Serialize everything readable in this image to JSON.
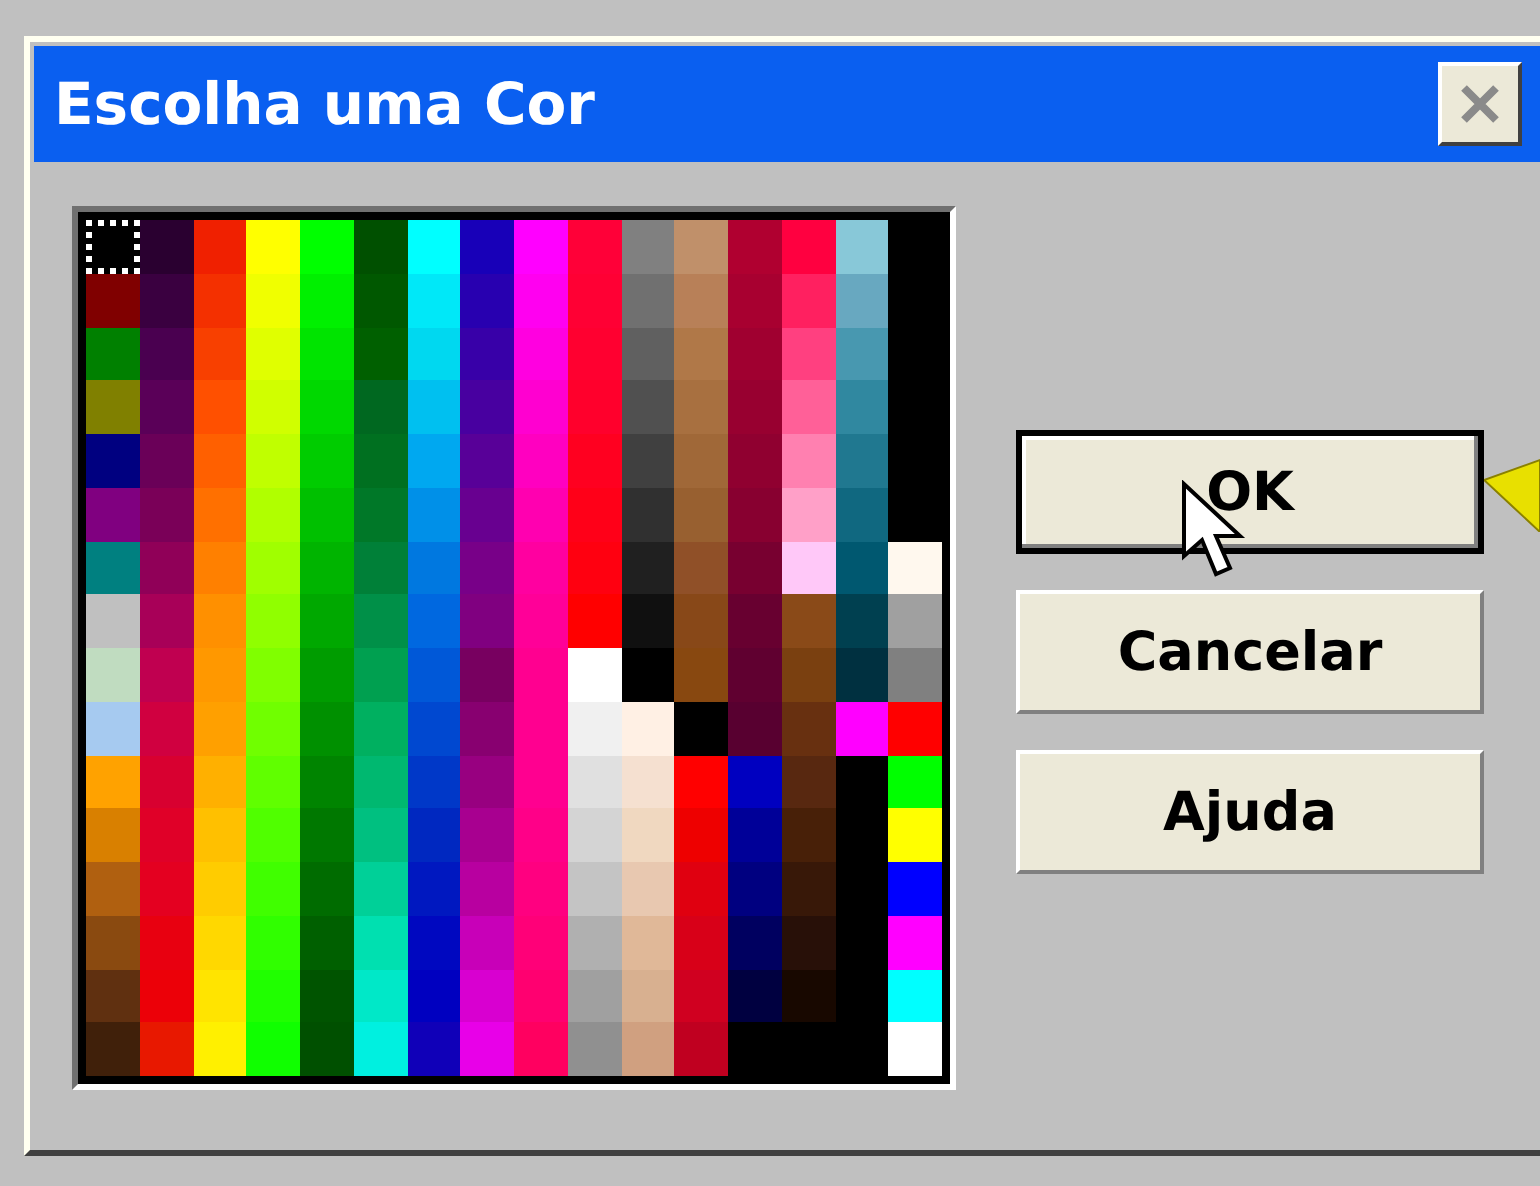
{
  "window": {
    "title": "Escolha uma Cor"
  },
  "palette": {
    "rows": [
      [
        {
          "color": "#000000",
          "selected": true
        },
        {
          "color": "#2a0030",
          "selected": false
        },
        {
          "color": "#f02000",
          "selected": false
        },
        {
          "color": "#ffff00",
          "selected": false
        },
        {
          "color": "#00ff00",
          "selected": false
        },
        {
          "color": "#005000",
          "selected": false
        },
        {
          "color": "#00ffff",
          "selected": false
        },
        {
          "color": "#1800b8",
          "selected": false
        },
        {
          "color": "#ff00ff",
          "selected": false
        },
        {
          "color": "#ff0038",
          "selected": false
        },
        {
          "color": "#808080",
          "selected": false
        },
        {
          "color": "#c0906a",
          "selected": false
        },
        {
          "color": "#b00030",
          "selected": false
        },
        {
          "color": "#ff0040",
          "selected": false
        },
        {
          "color": "#88c8d8",
          "selected": false
        },
        {
          "color": "#000000",
          "selected": false
        }
      ],
      [
        {
          "color": "#800000",
          "selected": false
        },
        {
          "color": "#3a0040",
          "selected": false
        },
        {
          "color": "#f43000",
          "selected": false
        },
        {
          "color": "#f0ff00",
          "selected": false
        },
        {
          "color": "#00f000",
          "selected": false
        },
        {
          "color": "#005800",
          "selected": false
        },
        {
          "color": "#00e8f8",
          "selected": false
        },
        {
          "color": "#2800b0",
          "selected": false
        },
        {
          "color": "#ff00f0",
          "selected": false
        },
        {
          "color": "#ff0034",
          "selected": false
        },
        {
          "color": "#707070",
          "selected": false
        },
        {
          "color": "#b88058",
          "selected": false
        },
        {
          "color": "#a80030",
          "selected": false
        },
        {
          "color": "#ff2060",
          "selected": false
        },
        {
          "color": "#68a8c0",
          "selected": false
        },
        {
          "color": "#000000",
          "selected": false
        }
      ],
      [
        {
          "color": "#008000",
          "selected": false
        },
        {
          "color": "#4a0050",
          "selected": false
        },
        {
          "color": "#f84000",
          "selected": false
        },
        {
          "color": "#e0ff00",
          "selected": false
        },
        {
          "color": "#00e400",
          "selected": false
        },
        {
          "color": "#006000",
          "selected": false
        },
        {
          "color": "#00d8f0",
          "selected": false
        },
        {
          "color": "#3800a8",
          "selected": false
        },
        {
          "color": "#ff00e0",
          "selected": false
        },
        {
          "color": "#ff0030",
          "selected": false
        },
        {
          "color": "#606060",
          "selected": false
        },
        {
          "color": "#b07848",
          "selected": false
        },
        {
          "color": "#a00030",
          "selected": false
        },
        {
          "color": "#ff4080",
          "selected": false
        },
        {
          "color": "#4898b0",
          "selected": false
        },
        {
          "color": "#000000",
          "selected": false
        }
      ],
      [
        {
          "color": "#808000",
          "selected": false
        },
        {
          "color": "#5a0058",
          "selected": false
        },
        {
          "color": "#ff5000",
          "selected": false
        },
        {
          "color": "#d0ff00",
          "selected": false
        },
        {
          "color": "#00d800",
          "selected": false
        },
        {
          "color": "#006820",
          "selected": false
        },
        {
          "color": "#00c0f0",
          "selected": false
        },
        {
          "color": "#4800a0",
          "selected": false
        },
        {
          "color": "#ff00d0",
          "selected": false
        },
        {
          "color": "#ff002c",
          "selected": false
        },
        {
          "color": "#505050",
          "selected": false
        },
        {
          "color": "#a87040",
          "selected": false
        },
        {
          "color": "#980030",
          "selected": false
        },
        {
          "color": "#ff6098",
          "selected": false
        },
        {
          "color": "#3088a0",
          "selected": false
        },
        {
          "color": "#000000",
          "selected": false
        }
      ],
      [
        {
          "color": "#000080",
          "selected": false
        },
        {
          "color": "#6a0058",
          "selected": false
        },
        {
          "color": "#ff6000",
          "selected": false
        },
        {
          "color": "#c0ff00",
          "selected": false
        },
        {
          "color": "#00cc00",
          "selected": false
        },
        {
          "color": "#007020",
          "selected": false
        },
        {
          "color": "#00a8f0",
          "selected": false
        },
        {
          "color": "#580098",
          "selected": false
        },
        {
          "color": "#ff00c0",
          "selected": false
        },
        {
          "color": "#ff0020",
          "selected": false
        },
        {
          "color": "#404040",
          "selected": false
        },
        {
          "color": "#a06838",
          "selected": false
        },
        {
          "color": "#900030",
          "selected": false
        },
        {
          "color": "#ff80b0",
          "selected": false
        },
        {
          "color": "#207890",
          "selected": false
        },
        {
          "color": "#000000",
          "selected": false
        }
      ],
      [
        {
          "color": "#800080",
          "selected": false
        },
        {
          "color": "#7a0058",
          "selected": false
        },
        {
          "color": "#ff7000",
          "selected": false
        },
        {
          "color": "#b0ff00",
          "selected": false
        },
        {
          "color": "#00c000",
          "selected": false
        },
        {
          "color": "#007828",
          "selected": false
        },
        {
          "color": "#0090e8",
          "selected": false
        },
        {
          "color": "#680090",
          "selected": false
        },
        {
          "color": "#ff00b0",
          "selected": false
        },
        {
          "color": "#ff0018",
          "selected": false
        },
        {
          "color": "#303030",
          "selected": false
        },
        {
          "color": "#986030",
          "selected": false
        },
        {
          "color": "#880030",
          "selected": false
        },
        {
          "color": "#ffa0c8",
          "selected": false
        },
        {
          "color": "#106880",
          "selected": false
        },
        {
          "color": "#000000",
          "selected": false
        }
      ],
      [
        {
          "color": "#008080",
          "selected": false
        },
        {
          "color": "#900058",
          "selected": false
        },
        {
          "color": "#ff8000",
          "selected": false
        },
        {
          "color": "#a0ff00",
          "selected": false
        },
        {
          "color": "#00b400",
          "selected": false
        },
        {
          "color": "#008038",
          "selected": false
        },
        {
          "color": "#0078e0",
          "selected": false
        },
        {
          "color": "#780088",
          "selected": false
        },
        {
          "color": "#ff00a0",
          "selected": false
        },
        {
          "color": "#ff0010",
          "selected": false
        },
        {
          "color": "#202020",
          "selected": false
        },
        {
          "color": "#905028",
          "selected": false
        },
        {
          "color": "#780030",
          "selected": false
        },
        {
          "color": "#ffc8f8",
          "selected": false
        },
        {
          "color": "#005870",
          "selected": false
        },
        {
          "color": "#fff8ee",
          "selected": false
        }
      ],
      [
        {
          "color": "#c0c0c0",
          "selected": false
        },
        {
          "color": "#a80058",
          "selected": false
        },
        {
          "color": "#ff9000",
          "selected": false
        },
        {
          "color": "#90ff00",
          "selected": false
        },
        {
          "color": "#00a800",
          "selected": false
        },
        {
          "color": "#009048",
          "selected": false
        },
        {
          "color": "#0068e0",
          "selected": false
        },
        {
          "color": "#800080",
          "selected": false
        },
        {
          "color": "#ff0098",
          "selected": false
        },
        {
          "color": "#ff0000",
          "selected": false
        },
        {
          "color": "#101010",
          "selected": false
        },
        {
          "color": "#884818",
          "selected": false
        },
        {
          "color": "#680030",
          "selected": false
        },
        {
          "color": "#8a4a18",
          "selected": false
        },
        {
          "color": "#004050",
          "selected": false
        },
        {
          "color": "#a0a0a0",
          "selected": false
        }
      ],
      [
        {
          "color": "#c0dcc0",
          "selected": false
        },
        {
          "color": "#c00050",
          "selected": false
        },
        {
          "color": "#ff9800",
          "selected": false
        },
        {
          "color": "#80ff00",
          "selected": false
        },
        {
          "color": "#009c00",
          "selected": false
        },
        {
          "color": "#00a050",
          "selected": false
        },
        {
          "color": "#0058d8",
          "selected": false
        },
        {
          "color": "#780060",
          "selected": false
        },
        {
          "color": "#ff0090",
          "selected": false
        },
        {
          "color": "#ffffff",
          "selected": false
        },
        {
          "color": "#000000",
          "selected": false
        },
        {
          "color": "#884810",
          "selected": false
        },
        {
          "color": "#600030",
          "selected": false
        },
        {
          "color": "#7a4010",
          "selected": false
        },
        {
          "color": "#003040",
          "selected": false
        },
        {
          "color": "#808080",
          "selected": false
        }
      ],
      [
        {
          "color": "#a6caf0",
          "selected": false
        },
        {
          "color": "#d00040",
          "selected": false
        },
        {
          "color": "#ffa000",
          "selected": false
        },
        {
          "color": "#70ff00",
          "selected": false
        },
        {
          "color": "#009000",
          "selected": false
        },
        {
          "color": "#00b060",
          "selected": false
        },
        {
          "color": "#0048d0",
          "selected": false
        },
        {
          "color": "#880070",
          "selected": false
        },
        {
          "color": "#ff0090",
          "selected": false
        },
        {
          "color": "#f0f0f0",
          "selected": false
        },
        {
          "color": "#fff0e4",
          "selected": false
        },
        {
          "color": "#000000",
          "selected": false
        },
        {
          "color": "#580030",
          "selected": false
        },
        {
          "color": "#683010",
          "selected": false
        },
        {
          "color": "#ff00ff",
          "selected": false
        },
        {
          "color": "#ff0000",
          "selected": false
        }
      ],
      [
        {
          "color": "#ffa200",
          "selected": false
        },
        {
          "color": "#d80030",
          "selected": false
        },
        {
          "color": "#ffb000",
          "selected": false
        },
        {
          "color": "#60ff00",
          "selected": false
        },
        {
          "color": "#008400",
          "selected": false
        },
        {
          "color": "#00b870",
          "selected": false
        },
        {
          "color": "#0038c8",
          "selected": false
        },
        {
          "color": "#980080",
          "selected": false
        },
        {
          "color": "#ff0090",
          "selected": false
        },
        {
          "color": "#e0e0e0",
          "selected": false
        },
        {
          "color": "#f5e0d0",
          "selected": false
        },
        {
          "color": "#ff0000",
          "selected": false
        },
        {
          "color": "#0000c0",
          "selected": false
        },
        {
          "color": "#582810",
          "selected": false
        },
        {
          "color": "#000000",
          "selected": false
        },
        {
          "color": "#00ff00",
          "selected": false
        }
      ],
      [
        {
          "color": "#d98000",
          "selected": false
        },
        {
          "color": "#e00028",
          "selected": false
        },
        {
          "color": "#ffc000",
          "selected": false
        },
        {
          "color": "#50ff00",
          "selected": false
        },
        {
          "color": "#007800",
          "selected": false
        },
        {
          "color": "#00c080",
          "selected": false
        },
        {
          "color": "#0028c0",
          "selected": false
        },
        {
          "color": "#a80090",
          "selected": false
        },
        {
          "color": "#ff0088",
          "selected": false
        },
        {
          "color": "#d4d4d4",
          "selected": false
        },
        {
          "color": "#f0d8c0",
          "selected": false
        },
        {
          "color": "#ee0000",
          "selected": false
        },
        {
          "color": "#000098",
          "selected": false
        },
        {
          "color": "#482008",
          "selected": false
        },
        {
          "color": "#000000",
          "selected": false
        },
        {
          "color": "#ffff00",
          "selected": false
        }
      ],
      [
        {
          "color": "#b06010",
          "selected": false
        },
        {
          "color": "#e40020",
          "selected": false
        },
        {
          "color": "#ffcc00",
          "selected": false
        },
        {
          "color": "#40ff00",
          "selected": false
        },
        {
          "color": "#006c00",
          "selected": false
        },
        {
          "color": "#00d098",
          "selected": false
        },
        {
          "color": "#0018c0",
          "selected": false
        },
        {
          "color": "#b800a0",
          "selected": false
        },
        {
          "color": "#ff0080",
          "selected": false
        },
        {
          "color": "#c4c4c4",
          "selected": false
        },
        {
          "color": "#e8c8b0",
          "selected": false
        },
        {
          "color": "#e00010",
          "selected": false
        },
        {
          "color": "#000080",
          "selected": false
        },
        {
          "color": "#381808",
          "selected": false
        },
        {
          "color": "#000000",
          "selected": false
        },
        {
          "color": "#0000ff",
          "selected": false
        }
      ],
      [
        {
          "color": "#8a4a10",
          "selected": false
        },
        {
          "color": "#e80010",
          "selected": false
        },
        {
          "color": "#ffd800",
          "selected": false
        },
        {
          "color": "#30ff00",
          "selected": false
        },
        {
          "color": "#006000",
          "selected": false
        },
        {
          "color": "#00e0b0",
          "selected": false
        },
        {
          "color": "#0008c0",
          "selected": false
        },
        {
          "color": "#c800b8",
          "selected": false
        },
        {
          "color": "#ff0078",
          "selected": false
        },
        {
          "color": "#b0b0b0",
          "selected": false
        },
        {
          "color": "#e0b898",
          "selected": false
        },
        {
          "color": "#d80018",
          "selected": false
        },
        {
          "color": "#000060",
          "selected": false
        },
        {
          "color": "#281008",
          "selected": false
        },
        {
          "color": "#000000",
          "selected": false
        },
        {
          "color": "#ff00ff",
          "selected": false
        }
      ],
      [
        {
          "color": "#603010",
          "selected": false
        },
        {
          "color": "#ec0008",
          "selected": false
        },
        {
          "color": "#ffe400",
          "selected": false
        },
        {
          "color": "#20ff00",
          "selected": false
        },
        {
          "color": "#005400",
          "selected": false
        },
        {
          "color": "#00e8c8",
          "selected": false
        },
        {
          "color": "#0000c0",
          "selected": false
        },
        {
          "color": "#d800d0",
          "selected": false
        },
        {
          "color": "#ff0070",
          "selected": false
        },
        {
          "color": "#a0a0a0",
          "selected": false
        },
        {
          "color": "#d8b090",
          "selected": false
        },
        {
          "color": "#d00020",
          "selected": false
        },
        {
          "color": "#000040",
          "selected": false
        },
        {
          "color": "#180800",
          "selected": false
        },
        {
          "color": "#000000",
          "selected": false
        },
        {
          "color": "#00ffff",
          "selected": false
        }
      ],
      [
        {
          "color": "#40200a",
          "selected": false
        },
        {
          "color": "#e81800",
          "selected": false
        },
        {
          "color": "#fff000",
          "selected": false
        },
        {
          "color": "#10ff00",
          "selected": false
        },
        {
          "color": "#005000",
          "selected": false
        },
        {
          "color": "#00f0e0",
          "selected": false
        },
        {
          "color": "#1000b8",
          "selected": false
        },
        {
          "color": "#e800e8",
          "selected": false
        },
        {
          "color": "#ff0060",
          "selected": false
        },
        {
          "color": "#909090",
          "selected": false
        },
        {
          "color": "#d0a080",
          "selected": false
        },
        {
          "color": "#c00020",
          "selected": false
        },
        {
          "color": "#000000",
          "selected": false
        },
        {
          "color": "#000000",
          "selected": false
        },
        {
          "color": "#000000",
          "selected": false
        },
        {
          "color": "#ffffff",
          "selected": false
        }
      ]
    ]
  },
  "buttons": [
    {
      "label": "OK",
      "default": true
    },
    {
      "label": "Cancelar",
      "default": false
    },
    {
      "label": "Ajuda",
      "default": false
    }
  ]
}
